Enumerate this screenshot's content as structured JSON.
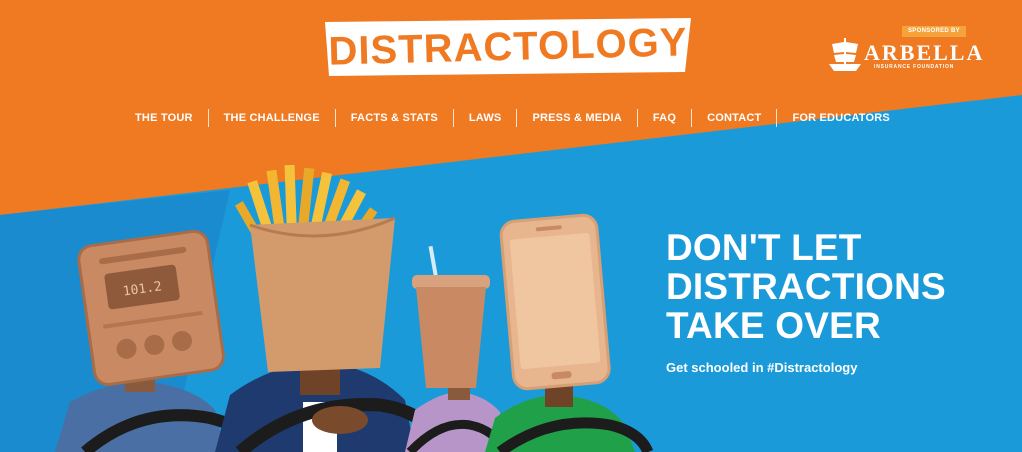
{
  "site": {
    "logo_text": "DISTRACTOLOGY"
  },
  "sponsor": {
    "badge": "SPONSORED BY",
    "name": "ARBELLA",
    "subtitle": "INSURANCE FOUNDATION",
    "ship_icon": "ship-icon"
  },
  "nav": {
    "items": [
      {
        "label": "THE TOUR"
      },
      {
        "label": "THE CHALLENGE"
      },
      {
        "label": "FACTS & STATS"
      },
      {
        "label": "LAWS"
      },
      {
        "label": "PRESS & MEDIA"
      },
      {
        "label": "FAQ"
      },
      {
        "label": "CONTACT"
      },
      {
        "label": "FOR EDUCATORS"
      }
    ]
  },
  "hero": {
    "headline_lines": [
      "DON'T LET",
      "DISTRACTIONS",
      "TAKE OVER"
    ],
    "subline": "Get schooled in #Distractology",
    "radio_display": "101.2"
  },
  "colors": {
    "orange": "#ef7a22",
    "blue": "#1b9ad9",
    "white": "#ffffff"
  }
}
